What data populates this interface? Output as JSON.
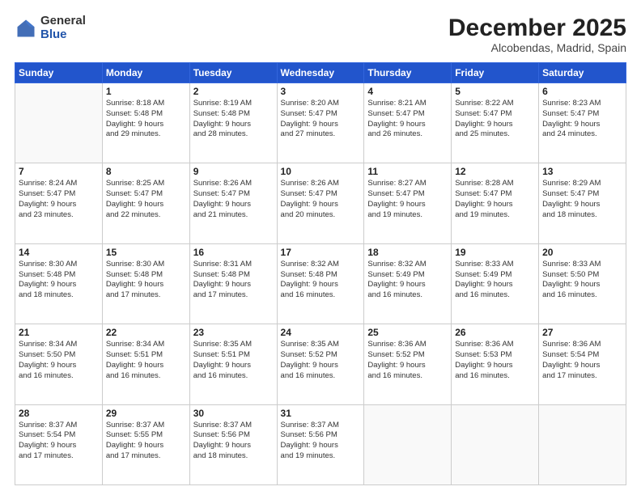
{
  "header": {
    "logo_general": "General",
    "logo_blue": "Blue",
    "month_title": "December 2025",
    "location": "Alcobendas, Madrid, Spain"
  },
  "weekdays": [
    "Sunday",
    "Monday",
    "Tuesday",
    "Wednesday",
    "Thursday",
    "Friday",
    "Saturday"
  ],
  "weeks": [
    [
      {
        "day": "",
        "info": ""
      },
      {
        "day": "1",
        "info": "Sunrise: 8:18 AM\nSunset: 5:48 PM\nDaylight: 9 hours\nand 29 minutes."
      },
      {
        "day": "2",
        "info": "Sunrise: 8:19 AM\nSunset: 5:48 PM\nDaylight: 9 hours\nand 28 minutes."
      },
      {
        "day": "3",
        "info": "Sunrise: 8:20 AM\nSunset: 5:47 PM\nDaylight: 9 hours\nand 27 minutes."
      },
      {
        "day": "4",
        "info": "Sunrise: 8:21 AM\nSunset: 5:47 PM\nDaylight: 9 hours\nand 26 minutes."
      },
      {
        "day": "5",
        "info": "Sunrise: 8:22 AM\nSunset: 5:47 PM\nDaylight: 9 hours\nand 25 minutes."
      },
      {
        "day": "6",
        "info": "Sunrise: 8:23 AM\nSunset: 5:47 PM\nDaylight: 9 hours\nand 24 minutes."
      }
    ],
    [
      {
        "day": "7",
        "info": "Sunrise: 8:24 AM\nSunset: 5:47 PM\nDaylight: 9 hours\nand 23 minutes."
      },
      {
        "day": "8",
        "info": "Sunrise: 8:25 AM\nSunset: 5:47 PM\nDaylight: 9 hours\nand 22 minutes."
      },
      {
        "day": "9",
        "info": "Sunrise: 8:26 AM\nSunset: 5:47 PM\nDaylight: 9 hours\nand 21 minutes."
      },
      {
        "day": "10",
        "info": "Sunrise: 8:26 AM\nSunset: 5:47 PM\nDaylight: 9 hours\nand 20 minutes."
      },
      {
        "day": "11",
        "info": "Sunrise: 8:27 AM\nSunset: 5:47 PM\nDaylight: 9 hours\nand 19 minutes."
      },
      {
        "day": "12",
        "info": "Sunrise: 8:28 AM\nSunset: 5:47 PM\nDaylight: 9 hours\nand 19 minutes."
      },
      {
        "day": "13",
        "info": "Sunrise: 8:29 AM\nSunset: 5:47 PM\nDaylight: 9 hours\nand 18 minutes."
      }
    ],
    [
      {
        "day": "14",
        "info": "Sunrise: 8:30 AM\nSunset: 5:48 PM\nDaylight: 9 hours\nand 18 minutes."
      },
      {
        "day": "15",
        "info": "Sunrise: 8:30 AM\nSunset: 5:48 PM\nDaylight: 9 hours\nand 17 minutes."
      },
      {
        "day": "16",
        "info": "Sunrise: 8:31 AM\nSunset: 5:48 PM\nDaylight: 9 hours\nand 17 minutes."
      },
      {
        "day": "17",
        "info": "Sunrise: 8:32 AM\nSunset: 5:48 PM\nDaylight: 9 hours\nand 16 minutes."
      },
      {
        "day": "18",
        "info": "Sunrise: 8:32 AM\nSunset: 5:49 PM\nDaylight: 9 hours\nand 16 minutes."
      },
      {
        "day": "19",
        "info": "Sunrise: 8:33 AM\nSunset: 5:49 PM\nDaylight: 9 hours\nand 16 minutes."
      },
      {
        "day": "20",
        "info": "Sunrise: 8:33 AM\nSunset: 5:50 PM\nDaylight: 9 hours\nand 16 minutes."
      }
    ],
    [
      {
        "day": "21",
        "info": "Sunrise: 8:34 AM\nSunset: 5:50 PM\nDaylight: 9 hours\nand 16 minutes."
      },
      {
        "day": "22",
        "info": "Sunrise: 8:34 AM\nSunset: 5:51 PM\nDaylight: 9 hours\nand 16 minutes."
      },
      {
        "day": "23",
        "info": "Sunrise: 8:35 AM\nSunset: 5:51 PM\nDaylight: 9 hours\nand 16 minutes."
      },
      {
        "day": "24",
        "info": "Sunrise: 8:35 AM\nSunset: 5:52 PM\nDaylight: 9 hours\nand 16 minutes."
      },
      {
        "day": "25",
        "info": "Sunrise: 8:36 AM\nSunset: 5:52 PM\nDaylight: 9 hours\nand 16 minutes."
      },
      {
        "day": "26",
        "info": "Sunrise: 8:36 AM\nSunset: 5:53 PM\nDaylight: 9 hours\nand 16 minutes."
      },
      {
        "day": "27",
        "info": "Sunrise: 8:36 AM\nSunset: 5:54 PM\nDaylight: 9 hours\nand 17 minutes."
      }
    ],
    [
      {
        "day": "28",
        "info": "Sunrise: 8:37 AM\nSunset: 5:54 PM\nDaylight: 9 hours\nand 17 minutes."
      },
      {
        "day": "29",
        "info": "Sunrise: 8:37 AM\nSunset: 5:55 PM\nDaylight: 9 hours\nand 17 minutes."
      },
      {
        "day": "30",
        "info": "Sunrise: 8:37 AM\nSunset: 5:56 PM\nDaylight: 9 hours\nand 18 minutes."
      },
      {
        "day": "31",
        "info": "Sunrise: 8:37 AM\nSunset: 5:56 PM\nDaylight: 9 hours\nand 19 minutes."
      },
      {
        "day": "",
        "info": ""
      },
      {
        "day": "",
        "info": ""
      },
      {
        "day": "",
        "info": ""
      }
    ]
  ]
}
